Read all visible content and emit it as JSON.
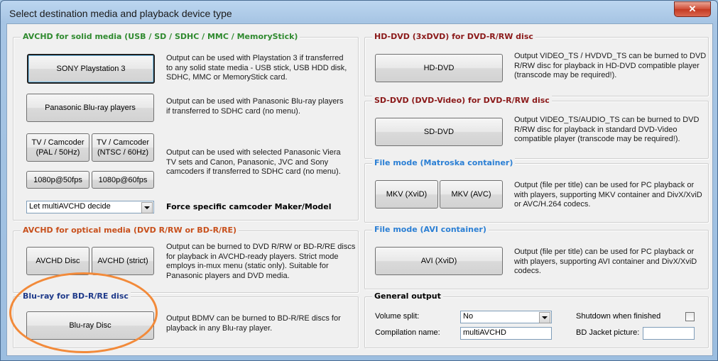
{
  "window": {
    "title": "Select destination media and playback device type",
    "close_glyph": "✕"
  },
  "avchd_solid": {
    "title": "AVCHD for solid media (USB / SD / SDHC / MMC / MemoryStick)",
    "ps3_button": "SONY Playstation 3",
    "ps3_desc": "Output can be used with Playstation 3 if transferred\nto any solid state media - USB stick, USB HDD disk,\nSDHC, MMC or MemoryStick card.",
    "panasonic_button": "Panasonic Blu-ray players",
    "panasonic_desc": "Output can be used with Panasonic Blu-ray players\nif transferred to SDHC card (no menu).",
    "tv_pal_button": "TV / Camcoder\n(PAL / 50Hz)",
    "tv_ntsc_button": "TV / Camcoder\n(NTSC / 60Hz)",
    "p50_button": "1080p@50fps",
    "p60_button": "1080p@60fps",
    "camcoder_desc": "Output can be used with selected Panasonic Viera\nTV sets and Canon, Panasonic, JVC and Sony\ncamcoders if transferred to SDHC card (no menu).",
    "maker_select_value": "Let multiAVCHD decide",
    "maker_label": "Force specific camcoder Maker/Model"
  },
  "avchd_optical": {
    "title": "AVCHD for optical media (DVD R/RW or BD-R/RE)",
    "disc_button": "AVCHD Disc",
    "strict_button": "AVCHD (strict)",
    "desc": "Output can be burned to DVD R/RW or BD-R/RE discs\nfor playback in AVCHD-ready players. Strict mode\nemploys in-mux menu (static only). Suitable for\nPanasonic players and DVD media."
  },
  "bluray": {
    "title": "Blu-ray for BD-R/RE disc",
    "button": "Blu-ray Disc",
    "desc": "Output BDMV can be burned to BD-R/RE discs for\nplayback in any Blu-ray player."
  },
  "hddvd": {
    "title": "HD-DVD (3xDVD) for DVD-R/RW disc",
    "button": "HD-DVD",
    "desc": "Output VIDEO_TS / HVDVD_TS can be burned to DVD\nR/RW disc for playback in HD-DVD compatible player\n(transcode may be required!)."
  },
  "sddvd": {
    "title": "SD-DVD (DVD-Video) for DVD-R/RW disc",
    "button": "SD-DVD",
    "desc": "Output VIDEO_TS/AUDIO_TS can be burned to DVD\nR/RW disc for playback in standard DVD-Video\ncompatible player (transcode may be required!)."
  },
  "mkv": {
    "title": "File mode (Matroska container)",
    "xvid_button": "MKV (XviD)",
    "avc_button": "MKV (AVC)",
    "desc": "Output (file per title) can be used for PC playback or\nwith players, supporting MKV container and DivX/XviD\nor AVC/H.264 codecs."
  },
  "avi": {
    "title": "File mode (AVI container)",
    "button": "AVI (XviD)",
    "desc": "Output (file per title) can be used for PC playback or\nwith players, supporting AVI container and DivX/XviD\ncodecs."
  },
  "general": {
    "title": "General output",
    "volume_split_label": "Volume split:",
    "volume_split_value": "No",
    "compilation_label": "Compilation name:",
    "compilation_value": "multiAVCHD",
    "shutdown_label": "Shutdown when finished",
    "jacket_label": "BD Jacket picture:",
    "jacket_value": ""
  },
  "colors": {
    "highlight_circle": "#f28a3a"
  }
}
